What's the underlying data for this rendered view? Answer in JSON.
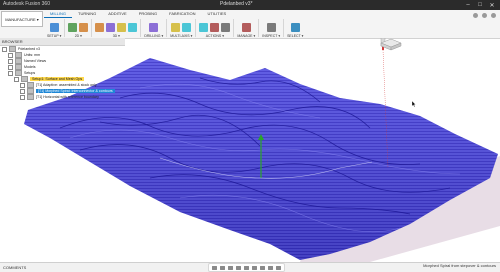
{
  "app": {
    "title": "Autodesk Fusion 360",
    "document": "Pdelanbed v3*"
  },
  "workspace": {
    "label": "MANUFACTURE ▾"
  },
  "tabs": [
    "MILLING",
    "TURNING",
    "ADDITIVE",
    "PROBING",
    "FABRICATION",
    "UTILITIES"
  ],
  "active_tab": "MILLING",
  "groups": [
    {
      "label": "SETUP ▾",
      "icons": [
        "setup-icon"
      ]
    },
    {
      "label": "2D ▾",
      "icons": [
        "2d-adaptive-icon",
        "2d-pocket-icon"
      ]
    },
    {
      "label": "3D ▾",
      "icons": [
        "3d-adaptive-icon",
        "3d-pocket-icon",
        "3d-steep-icon",
        "3d-parallel-icon"
      ]
    },
    {
      "label": "DRILLING ▾",
      "icons": [
        "drilling-icon"
      ]
    },
    {
      "label": "MULTI-AXIS ▾",
      "icons": [
        "multi-axis-icon",
        "swarf-icon"
      ]
    },
    {
      "label": "ACTIONS ▾",
      "icons": [
        "simulate-icon",
        "post-icon",
        "setup-sheet-icon"
      ]
    },
    {
      "label": "MANAGE ▾",
      "icons": [
        "tool-library-icon"
      ]
    },
    {
      "label": "INSPECT ▾",
      "icons": [
        "inspect-icon"
      ]
    },
    {
      "label": "SELECT ▾",
      "icons": [
        "select-icon"
      ]
    }
  ],
  "browser": {
    "header": "BROWSER",
    "items": [
      {
        "label": "Pdelanbed v3",
        "indent": 0
      },
      {
        "label": "Units: mm",
        "indent": 1
      },
      {
        "label": "Named Views",
        "indent": 1
      },
      {
        "label": "Models",
        "indent": 1
      },
      {
        "label": "Setups",
        "indent": 1
      },
      {
        "label": "Setup1: Surface and Mesh Ops",
        "indent": 2,
        "style": "yellow"
      },
      {
        "label": "[T1] Adaptive: assembled & stock only",
        "indent": 3
      },
      {
        "label": "[T1] Morphed Spiral: Interconnector & contours",
        "indent": 3,
        "style": "blue"
      },
      {
        "label": "[T1] Horizontal with reference boundary",
        "indent": 3
      }
    ]
  },
  "comments": {
    "label": "COMMENTS"
  },
  "status": {
    "text": "Morphed Spiral from stepover & contours"
  },
  "colors": {
    "terrain": "#4f4bd8",
    "ribbon_accent": "#0b6fb8",
    "selection": "#1e87d6"
  }
}
